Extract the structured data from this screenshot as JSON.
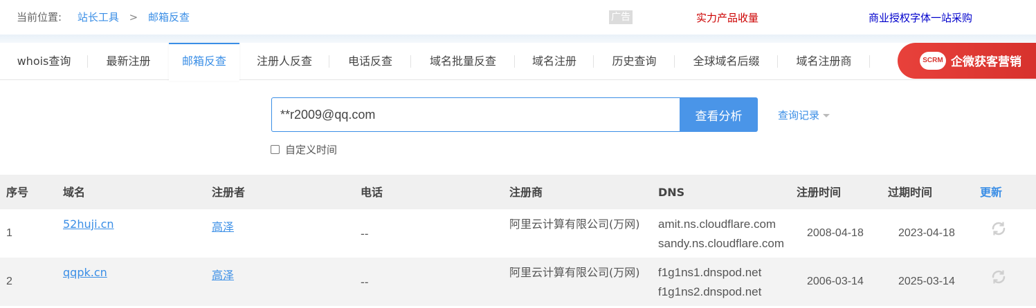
{
  "breadcrumb": {
    "lead": "当前位置:",
    "items": [
      "站长工具",
      "邮箱反查"
    ],
    "separator": ">"
  },
  "ads": {
    "tag": "广告",
    "red_link": "实力产品收量",
    "blue_link": "商业授权字体一站采购",
    "promo_badge": "SCRM",
    "promo_text": "企微获客营销"
  },
  "tabs": [
    {
      "label": "whois查询"
    },
    {
      "label": "最新注册"
    },
    {
      "label": "邮箱反查",
      "active": true
    },
    {
      "label": "注册人反查"
    },
    {
      "label": "电话反查"
    },
    {
      "label": "域名批量反查"
    },
    {
      "label": "域名注册"
    },
    {
      "label": "历史查询"
    },
    {
      "label": "全球域名后缀"
    },
    {
      "label": "域名注册商"
    }
  ],
  "search": {
    "value": "**r2009@qq.com",
    "button": "查看分析",
    "history": "查询记录",
    "custom_time": "自定义时间"
  },
  "table": {
    "headers": [
      "序号",
      "域名",
      "注册者",
      "电话",
      "注册商",
      "DNS",
      "注册时间",
      "过期时间",
      "更新"
    ],
    "rows": [
      {
        "index": "1",
        "domain": "52huji.cn",
        "registrant": "高泽",
        "phone": "--",
        "registrar": "阿里云计算有限公司(万网)",
        "dns": [
          "amit.ns.cloudflare.com",
          "sandy.ns.cloudflare.com"
        ],
        "created": "2008-04-18",
        "expires": "2023-04-18"
      },
      {
        "index": "2",
        "domain": "qqpk.cn",
        "registrant": "高泽",
        "phone": "--",
        "registrar": "阿里云计算有限公司(万网)",
        "dns": [
          "f1g1ns1.dnspod.net",
          "f1g1ns2.dnspod.net"
        ],
        "created": "2006-03-14",
        "expires": "2025-03-14"
      }
    ]
  },
  "colors": {
    "accent": "#3a8ee6",
    "button": "#4a95e8",
    "promo": "#d7322d",
    "ad_red": "#cc0000",
    "ad_blue": "#0000cc"
  }
}
